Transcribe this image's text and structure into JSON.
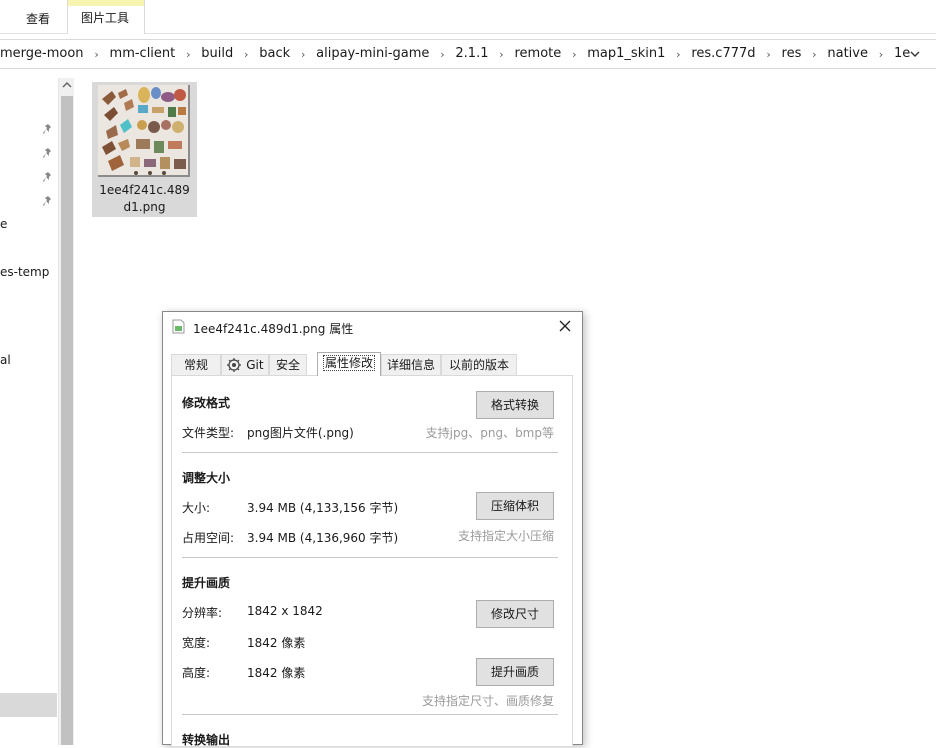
{
  "ribbon": {
    "tab_view": "查看",
    "tab_picture_tools": "图片工具"
  },
  "address": {
    "crumbs": [
      "merge-moon",
      "mm-client",
      "build",
      "back",
      "alipay-mini-game",
      "2.1.1",
      "remote",
      "map1_skin1",
      "res.c777d",
      "res",
      "native",
      "1e"
    ]
  },
  "nav": {
    "items": [
      "e",
      "es-temp",
      "al"
    ]
  },
  "file": {
    "name": "1ee4f241c.489d1.png"
  },
  "dialog": {
    "title": "1ee4f241c.489d1.png 属性",
    "tabs": [
      "常规",
      "Git",
      "安全",
      "属性修改",
      "详细信息",
      "以前的版本"
    ],
    "format": {
      "title": "修改格式",
      "button": "格式转换",
      "type_label": "文件类型:",
      "type_value": "png图片文件(.png)",
      "hint": "支持jpg、png、bmp等"
    },
    "size": {
      "title": "调整大小",
      "size_label": "大小:",
      "size_value": "3.94 MB (4,133,156 字节)",
      "disk_label": "占用空间:",
      "disk_value": "3.94 MB (4,136,960 字节)",
      "button": "压缩体积",
      "hint": "支持指定大小压缩"
    },
    "quality": {
      "title": "提升画质",
      "res_label": "分辨率:",
      "res_value": "1842 x 1842",
      "width_label": "宽度:",
      "width_value": "1842 像素",
      "height_label": "高度:",
      "height_value": "1842 像素",
      "resize_button": "修改尺寸",
      "enhance_button": "提升画质",
      "hint": "支持指定尺寸、画质修复"
    },
    "output": {
      "title": "转换输出"
    }
  }
}
